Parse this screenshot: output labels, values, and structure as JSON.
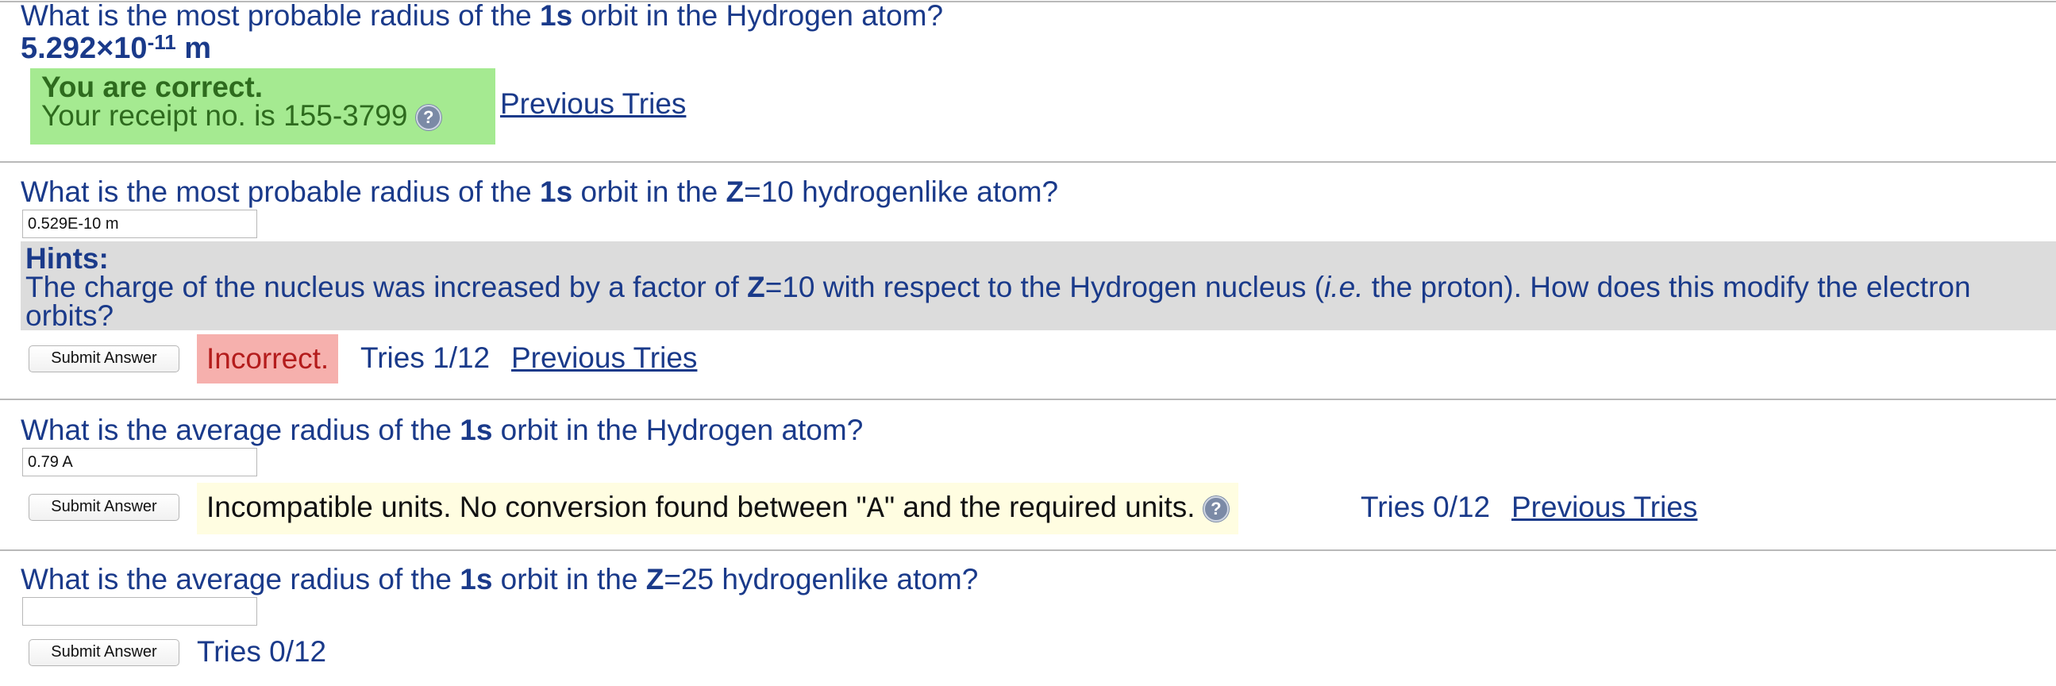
{
  "q1": {
    "question_parts": [
      "What is the most probable radius of the ",
      "1s",
      " orbit in the Hydrogen atom?"
    ],
    "answer_mantissa": "5.292×10",
    "answer_exp": "-11",
    "answer_unit": "m",
    "status_title": "You are correct.",
    "receipt": "Your receipt no. is 155-3799",
    "previous_tries": "Previous Tries"
  },
  "q2": {
    "question_parts": [
      "What is the most probable radius of the ",
      "1s",
      " orbit in the ",
      "Z",
      "=10 hydrogenlike atom?"
    ],
    "input_value": "0.529E-10 m",
    "hints_title": "Hints:",
    "hint_parts": [
      "The charge of the nucleus was increased by a factor of ",
      "Z",
      "=10 with respect to the Hydrogen nucleus (",
      "i.e.",
      " the proton). How does this modify the electron orbits?"
    ],
    "submit_label": "Submit Answer",
    "status": "Incorrect.",
    "tries": "Tries 1/12",
    "previous_tries": "Previous Tries"
  },
  "q3": {
    "question_parts": [
      "What is the average radius of the ",
      "1s",
      " orbit in the Hydrogen atom?"
    ],
    "input_value": "0.79 A",
    "submit_label": "Submit Answer",
    "message_parts": [
      "Incompatible units. No conversion found between \"",
      "A",
      "\" and the required units."
    ],
    "tries": "Tries 0/12",
    "previous_tries": "Previous Tries"
  },
  "q4": {
    "question_parts": [
      "What is the average radius of the ",
      "1s",
      " orbit in the ",
      "Z",
      "=25 hydrogenlike atom?"
    ],
    "input_value": "",
    "submit_label": "Submit Answer",
    "tries": "Tries 0/12"
  },
  "icons": {
    "help": "help-question-icon"
  },
  "colors": {
    "text_blue": "#1a3a8a",
    "correct_bg": "#a5ea91",
    "incorrect_bg": "#f6b0ad",
    "hints_bg": "#dcdcdc",
    "warning_bg": "#fffde1"
  }
}
